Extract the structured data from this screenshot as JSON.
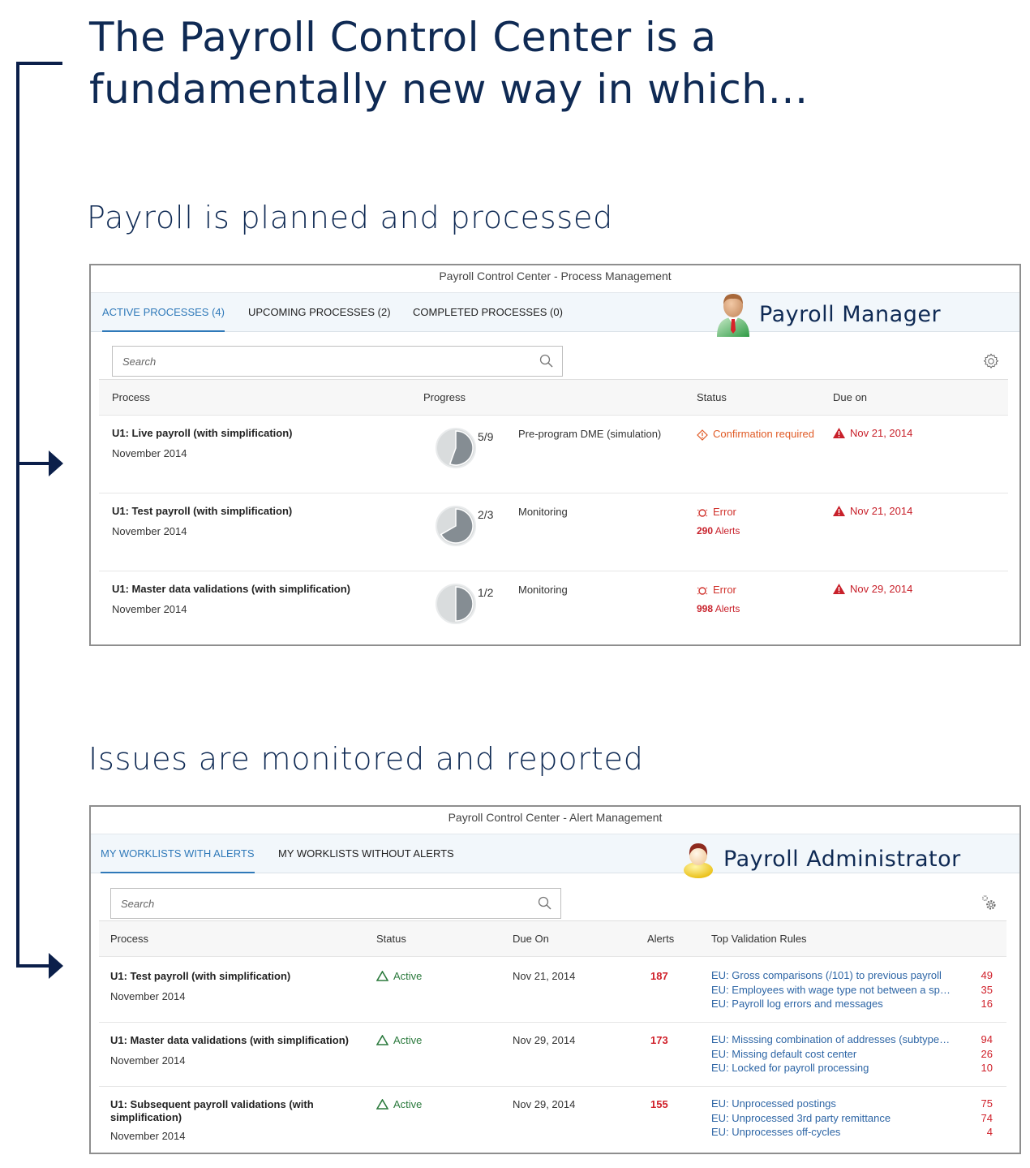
{
  "headline": {
    "line1": "The Payroll Control Center is a",
    "line2": "fundamentally new way in which…"
  },
  "section1": {
    "title": "Payroll is planned and processed"
  },
  "section2": {
    "title": "Issues are monitored and reported"
  },
  "process_panel": {
    "title": "Payroll Control Center - Process Management",
    "role": "Payroll Manager",
    "tabs": [
      {
        "label": "ACTIVE PROCESSES (4)",
        "active": true
      },
      {
        "label": "UPCOMING PROCESSES (2)",
        "active": false
      },
      {
        "label": "COMPLETED PROCESSES (0)",
        "active": false
      }
    ],
    "search_placeholder": "Search",
    "columns": [
      "Process",
      "Progress",
      "Status",
      "Due on"
    ],
    "rows": [
      {
        "name": "U1: Live payroll (with simplification)",
        "period": "November 2014",
        "progress_label": "5/9",
        "progress_fraction": 0.556,
        "step": "Pre-program DME (simulation)",
        "status": "Confirmation required",
        "status_icon": "warning-diamond-icon",
        "alerts_count": "",
        "alerts_label": "",
        "due": "Nov 21, 2014"
      },
      {
        "name": "U1: Test payroll (with simplification)",
        "period": "November 2014",
        "progress_label": "2/3",
        "progress_fraction": 0.667,
        "step": "Monitoring",
        "status": "Error",
        "status_icon": "error-icon",
        "alerts_count": "290",
        "alerts_label": "Alerts",
        "due": "Nov 21, 2014"
      },
      {
        "name": "U1: Master data validations (with simplification)",
        "period": "November 2014",
        "progress_label": "1/2",
        "progress_fraction": 0.5,
        "step": "Monitoring",
        "status": "Error",
        "status_icon": "error-icon",
        "alerts_count": "998",
        "alerts_label": "Alerts",
        "due": "Nov 29, 2014"
      }
    ]
  },
  "alert_panel": {
    "title": "Payroll Control Center - Alert Management",
    "role": "Payroll Administrator",
    "tabs": [
      {
        "label": "MY WORKLISTS WITH ALERTS",
        "active": true
      },
      {
        "label": "MY WORKLISTS WITHOUT ALERTS",
        "active": false
      }
    ],
    "search_placeholder": "Search",
    "columns": [
      "Process",
      "Status",
      "Due On",
      "Alerts",
      "Top Validation Rules"
    ],
    "rows": [
      {
        "name": "U1: Test payroll (with simplification)",
        "period": "November 2014",
        "status": "Active",
        "due": "Nov 21, 2014",
        "alerts": "187",
        "rules": [
          {
            "label": "EU: Gross comparisons (/101) to previous payroll",
            "count": "49"
          },
          {
            "label": "EU: Employees with wage type not between a sp…",
            "count": "35"
          },
          {
            "label": "EU: Payroll log errors and messages",
            "count": "16"
          }
        ]
      },
      {
        "name": "U1: Master data validations (with simplification)",
        "period": "November 2014",
        "status": "Active",
        "due": "Nov 29, 2014",
        "alerts": "173",
        "rules": [
          {
            "label": "EU: Misssing combination of addresses (subtype…",
            "count": "94"
          },
          {
            "label": "EU: Missing default cost center",
            "count": "26"
          },
          {
            "label": "EU: Locked for payroll processing",
            "count": "10"
          }
        ]
      },
      {
        "name_line1": "U1: Subsequent payroll validations (with",
        "name_line2": "simplification)",
        "period": "November 2014",
        "status": "Active",
        "due": "Nov 29, 2014",
        "alerts": "155",
        "rules": [
          {
            "label": "EU: Unprocessed postings",
            "count": "75"
          },
          {
            "label": "EU: Unprocessed 3rd party remittance",
            "count": "74"
          },
          {
            "label": "EU: Unprocesses off-cycles",
            "count": "4"
          }
        ]
      }
    ]
  },
  "colors": {
    "navy": "#0f2a54",
    "tab_active": "#2f79b9",
    "error_red": "#d0322c",
    "warning_orange": "#e05a25",
    "active_green": "#2b7a3d",
    "link_blue": "#2d65a5"
  }
}
